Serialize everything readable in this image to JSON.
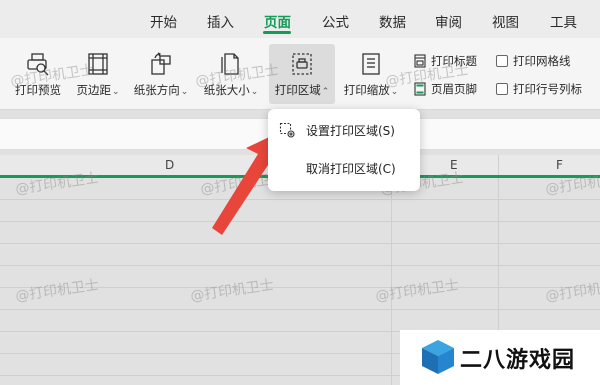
{
  "tabs": [
    "开始",
    "插入",
    "页面",
    "公式",
    "数据",
    "审阅",
    "视图",
    "工具"
  ],
  "active_tab_index": 2,
  "ribbon": {
    "print_preview": "打印预览",
    "margins": "页边距",
    "orientation": "纸张方向",
    "size": "纸张大小",
    "print_area": "打印区域",
    "print_scale": "打印缩放",
    "print_titles": "打印标题",
    "header_footer": "页眉页脚",
    "print_gridlines": "打印网格线",
    "print_row_col_headers": "打印行号列标"
  },
  "menu": {
    "set_print_area": "设置打印区域(S)",
    "cancel_print_area": "取消打印区域(C)"
  },
  "columns": [
    "D",
    "E",
    "F"
  ],
  "watermark_text": "@打印机卫士",
  "logo_text": "二八游戏园",
  "colors": {
    "accent": "#159a58",
    "arrow": "#e8463a"
  }
}
